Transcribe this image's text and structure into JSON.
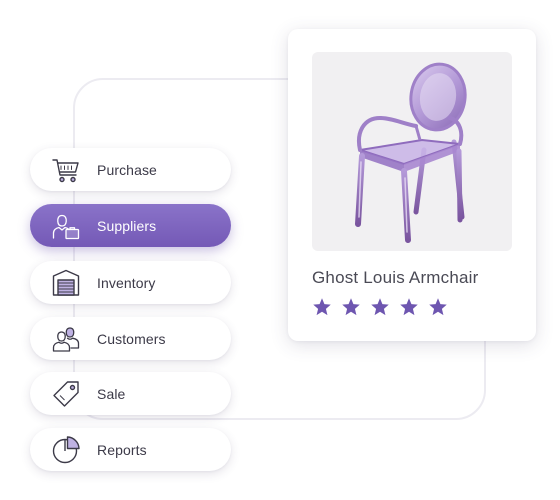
{
  "menu": {
    "items": [
      {
        "label": "Purchase",
        "icon": "shopping-cart-icon",
        "active": false
      },
      {
        "label": "Suppliers",
        "icon": "supplier-person-icon",
        "active": true
      },
      {
        "label": "Inventory",
        "icon": "warehouse-icon",
        "active": false
      },
      {
        "label": "Customers",
        "icon": "customers-icon",
        "active": false
      },
      {
        "label": "Sale",
        "icon": "price-tag-icon",
        "active": false
      },
      {
        "label": "Reports",
        "icon": "pie-chart-icon",
        "active": false
      }
    ]
  },
  "product": {
    "name": "Ghost Louis Armchair",
    "rating": 5,
    "rating_max": 5
  },
  "colors": {
    "accent": "#7a62bd",
    "star": "#6e56b0",
    "text": "#3c3a48"
  }
}
